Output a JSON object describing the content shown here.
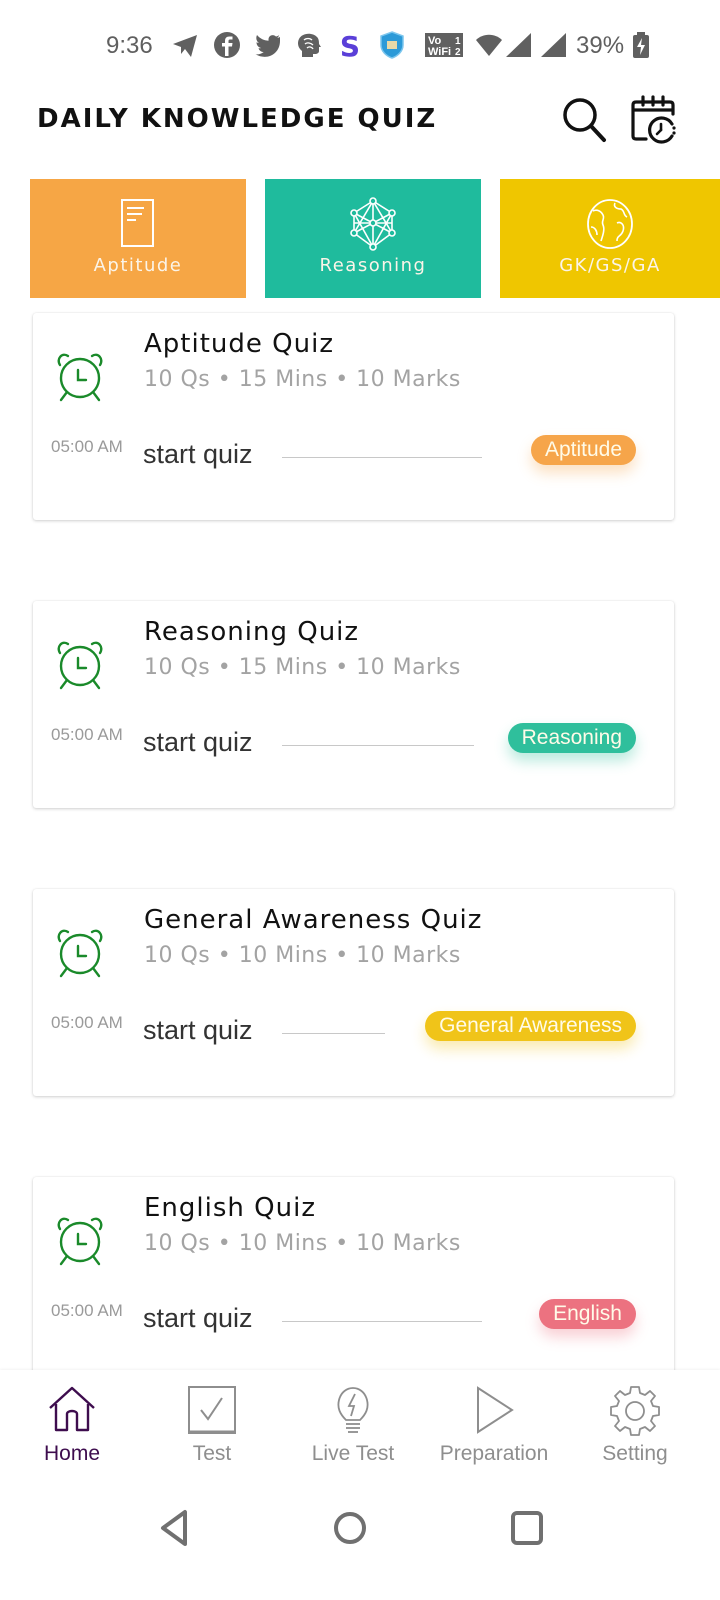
{
  "status_bar": {
    "time": "9:36",
    "icons": [
      "telegram-icon",
      "facebook-icon",
      "twitter-icon",
      "brain-app-icon",
      "s-app-icon",
      "shield-app-icon",
      "vowifi-icon",
      "wifi-icon",
      "signal-icon",
      "signal-icon",
      "battery-charging-icon"
    ],
    "vowifi_text_top": "Vo",
    "vowifi_text_bottom": "WiFi",
    "battery": "39%"
  },
  "header": {
    "title": "DAILY KNOWLEDGE QUIZ",
    "search_icon": "search-icon",
    "calendar_icon": "calendar-clock-icon"
  },
  "categories": [
    {
      "label": "Aptitude",
      "icon": "document-icon",
      "color": "#f6a645"
    },
    {
      "label": "Reasoning",
      "icon": "network-icon",
      "color": "#1fbb9d"
    },
    {
      "label": "GK/GS/GA",
      "icon": "globe-icon",
      "color": "#efc600"
    }
  ],
  "quizzes": [
    {
      "title": "Aptitude Quiz",
      "meta": "10 Qs • 15 Mins • 10 Marks",
      "time": "05:00 AM",
      "action": "start quiz",
      "badge": "Aptitude",
      "badge_color": "#f6a54a"
    },
    {
      "title": "Reasoning Quiz",
      "meta": "10 Qs • 15 Mins • 10 Marks",
      "time": "05:00 AM",
      "action": "start quiz",
      "badge": "Reasoning",
      "badge_color": "#2fbf9c"
    },
    {
      "title": "General Awareness Quiz",
      "meta": "10 Qs • 10 Mins • 10 Marks",
      "time": "05:00 AM",
      "action": "start quiz",
      "badge": "General Awareness",
      "badge_color": "#f0c419"
    },
    {
      "title": "English Quiz",
      "meta": "10 Qs • 10 Mins • 10 Marks",
      "time": "05:00 AM",
      "action": "start quiz",
      "badge": "English",
      "badge_color": "#ec7280"
    }
  ],
  "bottom_nav": [
    {
      "label": "Home",
      "icon": "home-icon",
      "active": true
    },
    {
      "label": "Test",
      "icon": "checkbox-icon",
      "active": false
    },
    {
      "label": "Live Test",
      "icon": "lightbulb-icon",
      "active": false
    },
    {
      "label": "Preparation",
      "icon": "play-icon",
      "active": false
    },
    {
      "label": "Setting",
      "icon": "gear-icon",
      "active": false
    }
  ],
  "colors": {
    "accent": "#3e0d4e",
    "alarm": "#1a8a2a",
    "nav_inactive": "#8e8e8e"
  }
}
